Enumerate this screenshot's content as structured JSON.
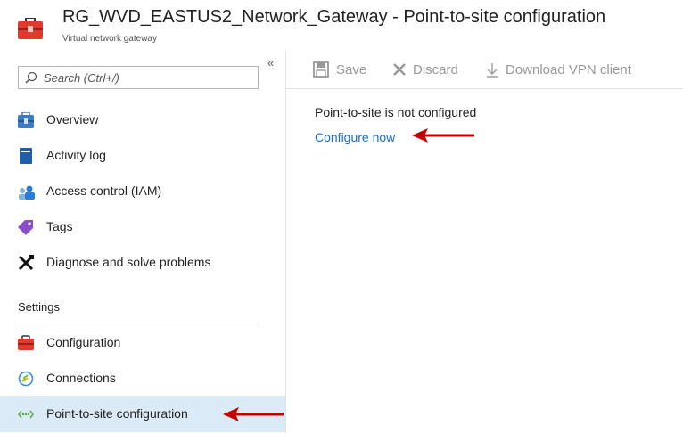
{
  "header": {
    "title": "RG_WVD_EASTUS2_Network_Gateway - Point-to-site configuration",
    "subtitle": "Virtual network gateway"
  },
  "search": {
    "placeholder": "Search (Ctrl+/)"
  },
  "sidebar": {
    "collapse_glyph": "«",
    "items": [
      {
        "label": "Overview",
        "icon": "overview-icon"
      },
      {
        "label": "Activity log",
        "icon": "activity-log-icon"
      },
      {
        "label": "Access control (IAM)",
        "icon": "iam-icon"
      },
      {
        "label": "Tags",
        "icon": "tag-icon"
      },
      {
        "label": "Diagnose and solve problems",
        "icon": "wrench-icon"
      }
    ],
    "section": "Settings",
    "settings_items": [
      {
        "label": "Configuration",
        "icon": "toolbox-icon"
      },
      {
        "label": "Connections",
        "icon": "connections-icon"
      },
      {
        "label": "Point-to-site configuration",
        "icon": "point-to-site-icon",
        "active": true
      }
    ]
  },
  "toolbar": {
    "save": "Save",
    "discard": "Discard",
    "download": "Download VPN client"
  },
  "main": {
    "status": "Point-to-site is not configured",
    "configure_link": "Configure now"
  },
  "colors": {
    "accent_blue": "#1a6fc4",
    "active_bg": "#dbeaf7",
    "annotation_red": "#c00000",
    "toolbar_disabled": "#999999"
  }
}
